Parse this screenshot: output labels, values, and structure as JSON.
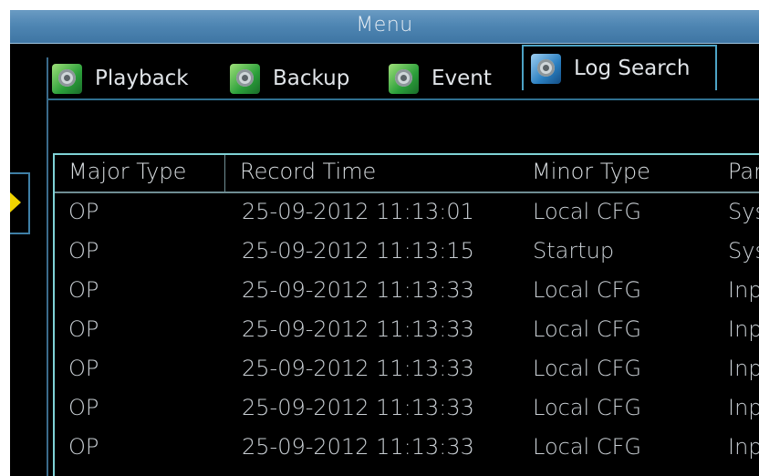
{
  "window": {
    "title": "Menu"
  },
  "tabs": [
    {
      "label": "Playback",
      "active": false,
      "icon": "gear-icon"
    },
    {
      "label": "Backup",
      "active": false,
      "icon": "gear-icon"
    },
    {
      "label": "Event",
      "active": false,
      "icon": "gear-icon"
    },
    {
      "label": "Log Search",
      "active": true,
      "icon": "gear-icon"
    }
  ],
  "table": {
    "columns": [
      "Major Type",
      "Record Time",
      "Minor Type",
      "Par"
    ],
    "rows": [
      {
        "major": "OP",
        "time": "25-09-2012 11:13:01",
        "minor": "Local CFG",
        "param": "Sys"
      },
      {
        "major": "OP",
        "time": "25-09-2012 11:13:15",
        "minor": "Startup",
        "param": "Sys"
      },
      {
        "major": "OP",
        "time": "25-09-2012 11:13:33",
        "minor": "Local CFG",
        "param": "Inp"
      },
      {
        "major": "OP",
        "time": "25-09-2012 11:13:33",
        "minor": "Local CFG",
        "param": "Inp"
      },
      {
        "major": "OP",
        "time": "25-09-2012 11:13:33",
        "minor": "Local CFG",
        "param": "Inp"
      },
      {
        "major": "OP",
        "time": "25-09-2012 11:13:33",
        "minor": "Local CFG",
        "param": "Inp"
      },
      {
        "major": "OP",
        "time": "25-09-2012 11:13:33",
        "minor": "Local CFG",
        "param": "Inp"
      }
    ]
  },
  "colors": {
    "titlebar": "#4f86b3",
    "table_border": "#7fd2d6",
    "arrow": "#f0d400"
  }
}
